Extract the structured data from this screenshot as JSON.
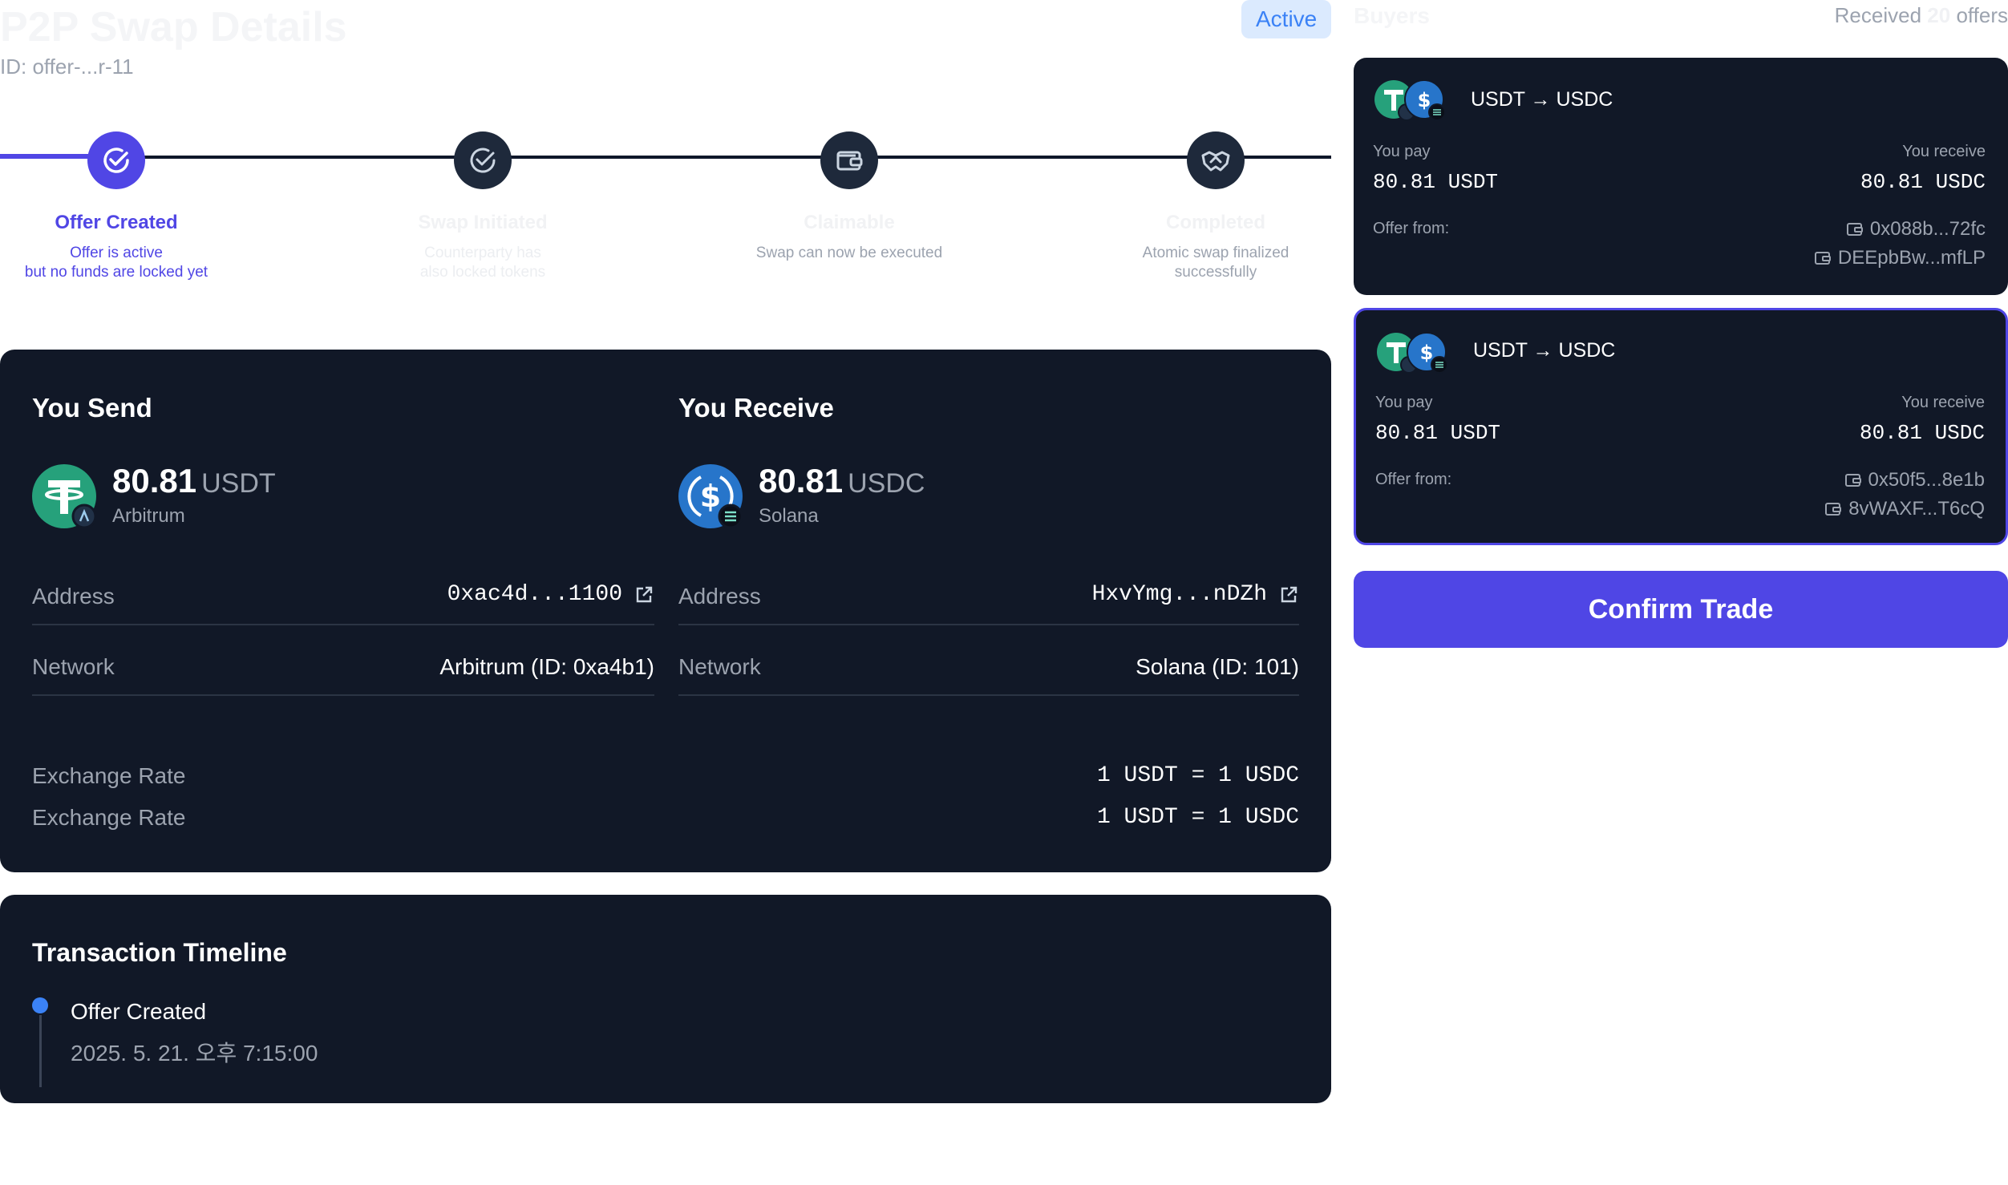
{
  "header": {
    "title": "P2P Swap Details",
    "offer_id": "ID: offer-...r-11",
    "status": "Active"
  },
  "steps": [
    {
      "label": "Offer Created",
      "desc1": "Offer is active",
      "desc2": "but no funds are locked yet",
      "icon": "check-circle-icon",
      "state": "active"
    },
    {
      "label": "Swap Initiated",
      "desc1": "Counterparty has",
      "desc2": "also locked tokens",
      "icon": "check-circle-icon",
      "state": "pending"
    },
    {
      "label": "Claimable",
      "desc1": "Swap can now be executed",
      "desc2": "",
      "icon": "wallet-icon",
      "state": "pending"
    },
    {
      "label": "Completed",
      "desc1": "Atomic swap finalized",
      "desc2": "successfully",
      "icon": "handshake-icon",
      "state": "pending"
    }
  ],
  "send": {
    "title": "You Send",
    "amount": "80.81",
    "token": "USDT",
    "chain": "Arbitrum",
    "address_label": "Address",
    "address": "0xac4d...1100",
    "network_label": "Network",
    "network": "Arbitrum (ID: 0xa4b1)"
  },
  "receive": {
    "title": "You Receive",
    "amount": "80.81",
    "token": "USDC",
    "chain": "Solana",
    "address_label": "Address",
    "address": "HxvYmg...nDZh",
    "network_label": "Network",
    "network": "Solana (ID: 101)"
  },
  "rates": [
    {
      "label": "Exchange Rate",
      "value": "1 USDT = 1 USDC"
    },
    {
      "label": "Exchange Rate",
      "value": "1 USDT = 1 USDC"
    }
  ],
  "timeline": {
    "title": "Transaction Timeline",
    "events": [
      {
        "label": "Offer Created",
        "time": "2025. 5. 21. 오후 7:15:00"
      }
    ]
  },
  "buyers": {
    "title": "Buyers",
    "received_prefix": "Received",
    "count": "20",
    "received_suffix": "offers"
  },
  "offers": [
    {
      "pair": "USDT → USDC",
      "pay_label": "You pay",
      "pay": "80.81 USDT",
      "receive_label": "You receive",
      "receive": "80.81 USDC",
      "from_label": "Offer from:",
      "addr1": "0x088b...72fc",
      "addr2": "DEEpbBw...mfLP",
      "selected": false
    },
    {
      "pair": "USDT → USDC",
      "pay_label": "You pay",
      "pay": "80.81 USDT",
      "receive_label": "You receive",
      "receive": "80.81 USDC",
      "from_label": "Offer from:",
      "addr1": "0x50f5...8e1b",
      "addr2": "8vWAXF...T6cQ",
      "selected": true
    }
  ],
  "confirm_label": "Confirm Trade",
  "colors": {
    "accent": "#4f46e5",
    "card": "#111827",
    "usdt": "#26a17b",
    "usdc": "#2775ca",
    "timeline_dot": "#3b82f6"
  }
}
